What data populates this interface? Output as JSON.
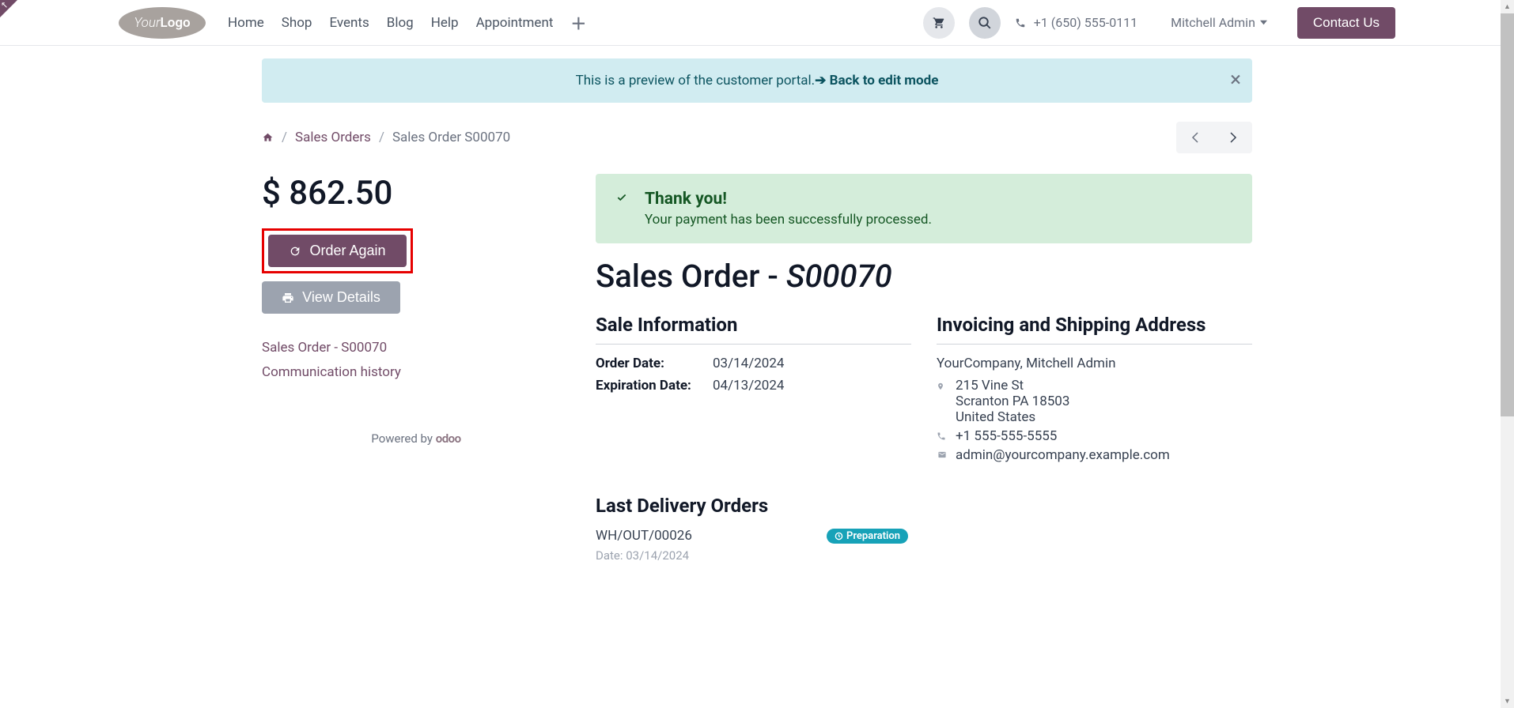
{
  "nav": {
    "items": [
      {
        "label": "Home"
      },
      {
        "label": "Shop"
      },
      {
        "label": "Events"
      },
      {
        "label": "Blog"
      },
      {
        "label": "Help"
      },
      {
        "label": "Appointment"
      }
    ]
  },
  "header": {
    "phone": "+1 (650) 555-0111",
    "user": "Mitchell Admin",
    "contact_btn": "Contact Us"
  },
  "preview": {
    "text": "This is a preview of the customer portal. ",
    "link": "Back to edit mode"
  },
  "breadcrumb": {
    "sales_orders": "Sales Orders",
    "current": "Sales Order S00070"
  },
  "sidebar": {
    "amount": "$ 862.50",
    "order_again": "Order Again",
    "view_details": "View Details",
    "link1": "Sales Order - S00070",
    "link2": "Communication history",
    "powered": "Powered by"
  },
  "alert": {
    "title": "Thank you!",
    "msg": "Your payment has been successfully processed."
  },
  "title": {
    "prefix": "Sales Order - ",
    "num": "S00070"
  },
  "sale_info": {
    "heading": "Sale Information",
    "order_date_label": "Order Date:",
    "order_date": "03/14/2024",
    "exp_date_label": "Expiration Date:",
    "exp_date": "04/13/2024"
  },
  "address": {
    "heading": "Invoicing and Shipping Address",
    "name": "YourCompany, Mitchell Admin",
    "street": "215 Vine St",
    "city": "Scranton PA 18503",
    "country": "United States",
    "phone": "+1 555-555-5555",
    "email": "admin@yourcompany.example.com"
  },
  "delivery": {
    "heading": "Last Delivery Orders",
    "ref": "WH/OUT/00026",
    "badge": "Preparation",
    "date_label": "Date:",
    "date": "03/14/2024"
  }
}
